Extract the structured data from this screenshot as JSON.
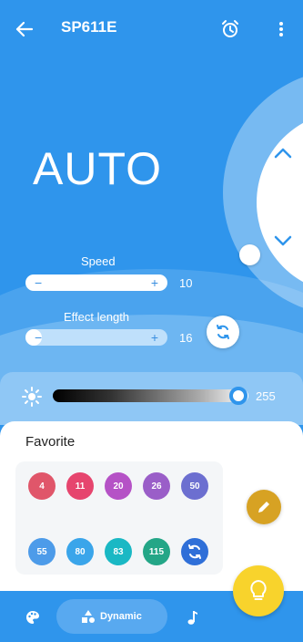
{
  "header": {
    "title": "SP611E",
    "back_icon": "arrow-left-icon",
    "alarm_icon": "alarm-clock-icon",
    "more_icon": "more-vertical-icon"
  },
  "mode": {
    "label": "AUTO"
  },
  "speed": {
    "label": "Speed",
    "value": "10",
    "minus": "−",
    "plus": "+"
  },
  "effect_length": {
    "label": "Effect length",
    "value": "16",
    "minus": "−",
    "plus": "+"
  },
  "brightness": {
    "value": "255",
    "level": 1.0
  },
  "favorite": {
    "title": "Favorite",
    "chips": [
      {
        "label": "4",
        "color": "#e0566a"
      },
      {
        "label": "11",
        "color": "#e6456e"
      },
      {
        "label": "20",
        "color": "#b552c6"
      },
      {
        "label": "26",
        "color": "#9a5ec8"
      },
      {
        "label": "50",
        "color": "#6c6fd0"
      },
      {
        "label": "55",
        "color": "#4d9be9"
      },
      {
        "label": "80",
        "color": "#3aa5ea"
      },
      {
        "label": "83",
        "color": "#1ab8c4"
      },
      {
        "label": "115",
        "color": "#24a687"
      },
      {
        "label": "",
        "color": "#2f6fd8",
        "icon": "refresh-icon"
      }
    ]
  },
  "bottom_nav": {
    "palette_icon": "palette-icon",
    "dynamic_label": "Dynamic",
    "dynamic_icon": "shapes-icon",
    "music_icon": "music-note-icon",
    "fab_icon": "lightbulb-icon"
  },
  "colors": {
    "primary": "#2f95ec",
    "accent": "#f8d32c",
    "edit": "#d7a223"
  }
}
